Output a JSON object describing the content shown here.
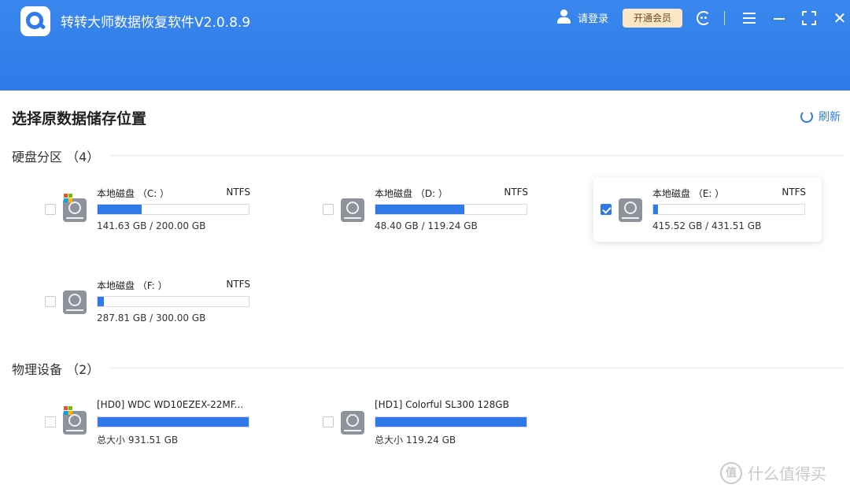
{
  "header": {
    "app_title": "转转大师数据恢复软件V2.0.8.9",
    "login_label": "请登录",
    "vip_label": "开通会员",
    "icons": [
      "app-logo-icon",
      "user-icon",
      "support-icon",
      "menu-icon",
      "minimize-icon",
      "maximize-icon",
      "close-icon"
    ]
  },
  "main": {
    "title": "选择原数据储存位置",
    "refresh_label": "刷新"
  },
  "partitions": {
    "label": "硬盘分区 （4）",
    "items": [
      {
        "name": "本地磁盘 （C: ）",
        "fs": "NTFS",
        "size": "141.63 GB / 200.00 GB",
        "used_fraction": 0.29,
        "system": true,
        "checked": false
      },
      {
        "name": "本地磁盘 （D: ）",
        "fs": "NTFS",
        "size": "48.40 GB / 119.24 GB",
        "used_fraction": 0.59,
        "system": false,
        "checked": false
      },
      {
        "name": "本地磁盘 （E: ）",
        "fs": "NTFS",
        "size": "415.52 GB / 431.51 GB",
        "used_fraction": 0.03,
        "system": false,
        "checked": true
      },
      {
        "name": "本地磁盘 （F: ）",
        "fs": "NTFS",
        "size": "287.81 GB / 300.00 GB",
        "used_fraction": 0.04,
        "system": false,
        "checked": false
      }
    ]
  },
  "devices": {
    "label": "物理设备 （2）",
    "items": [
      {
        "name": "[HD0] WDC WD10EZEX-22MF...",
        "size": "总大小 931.51 GB",
        "used_fraction": 1.0,
        "system": true,
        "checked": false
      },
      {
        "name": "[HD1] Colorful SL300 128GB",
        "size": "总大小 119.24 GB",
        "used_fraction": 1.0,
        "system": false,
        "checked": false
      }
    ]
  },
  "watermark": {
    "logo_text": "值",
    "text": "什么值得买"
  },
  "colors": {
    "accent": "#2f7ae8",
    "vip_bg": "#fbe7c6"
  }
}
